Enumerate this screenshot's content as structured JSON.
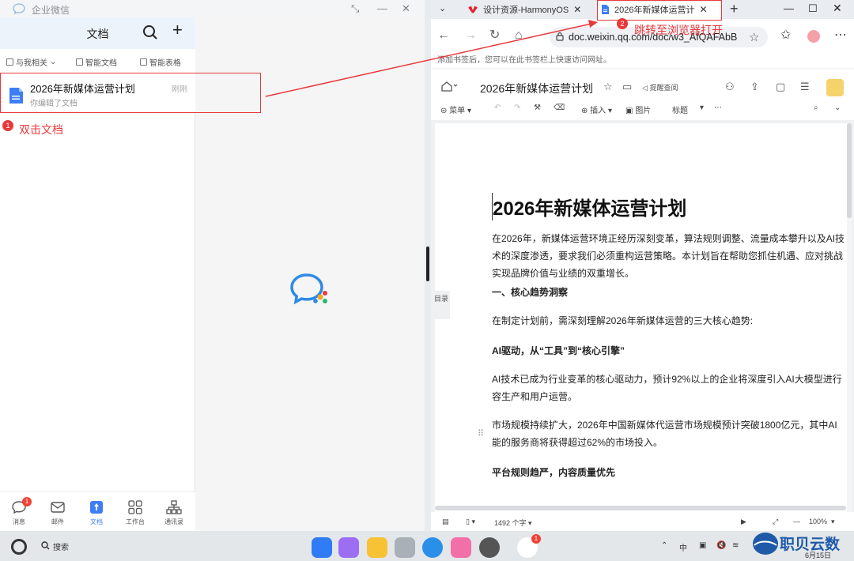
{
  "wecom": {
    "app_title": "企业微信",
    "header_title": "文档",
    "filters": [
      "与我相关",
      "智能文档",
      "智能表格"
    ],
    "doc_item": {
      "title": "2026年新媒体运营计划",
      "subtitle": "你编辑了文档",
      "time": "刚刚"
    },
    "nav": [
      {
        "label": "消息",
        "badge": "1"
      },
      {
        "label": "邮件"
      },
      {
        "label": "文档"
      },
      {
        "label": "工作台"
      },
      {
        "label": "通讯录"
      }
    ]
  },
  "annotations": {
    "step1_num": "1",
    "step1_text": "双击文档",
    "step2_num": "2",
    "step2_text": "跳转至浏览器打开",
    "color": "#e8393c"
  },
  "browser": {
    "tabs": [
      {
        "label": "设计资源-HarmonyOS"
      },
      {
        "label": "2026年新媒体运营计"
      }
    ],
    "url": "doc.weixin.qq.com/doc/w3_AfQAFAbB",
    "bookmark_hint": "添加书签后，您可以在此书签栏上快速访问网址。"
  },
  "doc_app": {
    "title": "2026年新媒体运营计划",
    "remind_label": "提醒查阅",
    "toolbar": {
      "menu": "菜单",
      "insert": "插入",
      "image": "图片",
      "style": "标题"
    },
    "toc_label": "目录",
    "status": {
      "word_count": "1492 个字",
      "zoom": "100%"
    }
  },
  "document": {
    "heading": "2026年新媒体运营计划",
    "intro": [
      "在2026年，新媒体运营环境正经历深刻变革，算法规则调整、流量成本攀升以及AI技",
      "术的深度渗透，要求我们必须重构运营策略。本计划旨在帮助您抓住机遇、应对挑战",
      "实现品牌价值与业绩的双重增长。"
    ],
    "section1": "一、核心趋势洞察",
    "para1": "在制定计划前，需深刻理解2026年新媒体运营的三大核心趋势:",
    "sub1": "AI驱动，从“工具”到“核心引擎”",
    "para2": [
      "AI技术已成为行业变革的核心驱动力，预计92%以上的企业将深度引入AI大模型进行",
      "容生产和用户运营。"
    ],
    "para3": [
      "市场规模持续扩大，2026年中国新媒体代运营市场规模预计突破1800亿元，其中AI",
      "能的服务商将获得超过62%的市场投入。"
    ],
    "sub2": "平台规则趋严，内容质量优先"
  },
  "taskbar": {
    "search": "搜索",
    "wecom_badge": "1",
    "ime": "中",
    "date": "6月15日"
  },
  "watermark": {
    "text": "职贝云数"
  }
}
